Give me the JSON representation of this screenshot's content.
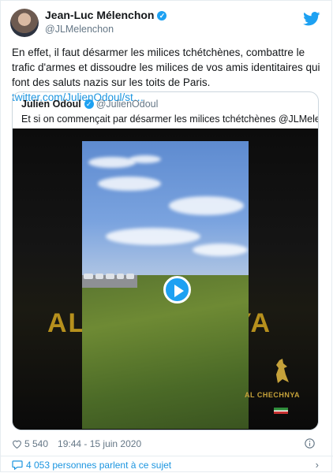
{
  "author": {
    "name": "Jean-Luc Mélenchon",
    "handle": "@JLMelenchon",
    "verified": true
  },
  "tweet": {
    "text": "En effet, il faut désarmer les milices tchétchènes, combattre le trafic d'armes et dissoudre les milices de vos amis identitaires qui font des saluts nazis sur les toits de Paris.",
    "link": "twitter.com/JulienOdoul/st…"
  },
  "quoted": {
    "name": "Julien Odoul",
    "handle": "@JulienOdoul",
    "verified": true,
    "text": "Et si on commençait par désarmer les milices tchétchènes @JLMelenchon ?",
    "video": {
      "overlay_left": "AL",
      "overlay_right": "YA",
      "logo_text": "AL CHECHNYA"
    }
  },
  "meta": {
    "likes": "5 540",
    "timestamp": "19:44 - 15 juin 2020"
  },
  "footer": {
    "text": "4 053 personnes parlent à ce sujet"
  },
  "colors": {
    "accent": "#1da1f2",
    "link": "#1b95e0",
    "muted": "#657786"
  },
  "icons": [
    "twitter-bird-icon",
    "verified-icon",
    "play-icon",
    "heart-icon",
    "info-icon",
    "comment-icon",
    "chevron-right-icon"
  ]
}
